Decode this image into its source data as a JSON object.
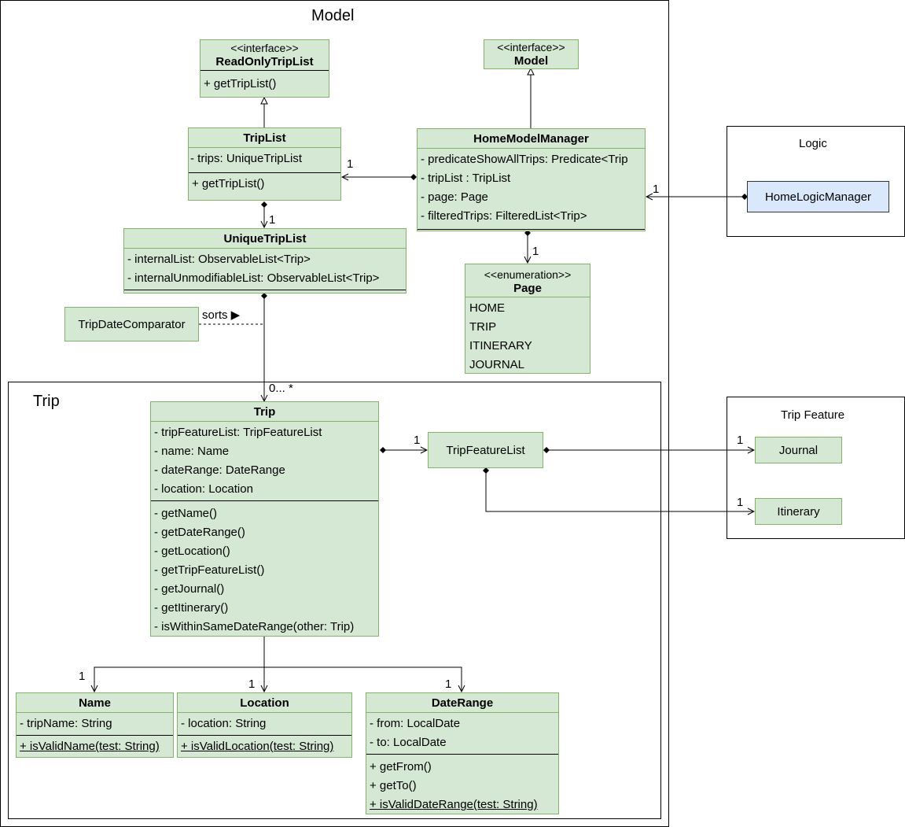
{
  "frames": {
    "model": "Model",
    "trip": "Trip",
    "logic": "Logic",
    "trip_feature": "Trip Feature"
  },
  "classes": {
    "read_only_trip_list": {
      "stereotype": "<<interface>>",
      "name": "ReadOnlyTripList",
      "methods": [
        "+ getTripList()"
      ]
    },
    "model_interface": {
      "stereotype": "<<interface>>",
      "name": "Model"
    },
    "trip_list": {
      "name": "TripList",
      "attributes": [
        "- trips: UniqueTripList"
      ],
      "methods": [
        "+ getTripList()"
      ]
    },
    "home_model_manager": {
      "name": "HomeModelManager",
      "attributes": [
        "- predicateShowAllTrips: Predicate<Trip",
        "- tripList : TripList",
        "- page: Page",
        "- filteredTrips: FilteredList<Trip>"
      ]
    },
    "unique_trip_list": {
      "name": "UniqueTripList",
      "attributes": [
        "- internalList: ObservableList<Trip>",
        "- internalUnmodifiableList: ObservableList<Trip>"
      ]
    },
    "page": {
      "stereotype": "<<enumeration>>",
      "name": "Page",
      "values": [
        "HOME",
        "TRIP",
        "ITINERARY",
        "JOURNAL"
      ]
    },
    "trip_date_comparator": {
      "name": "TripDateComparator"
    },
    "trip": {
      "name": "Trip",
      "attributes": [
        "- tripFeatureList: TripFeatureList",
        "- name: Name",
        "- dateRange: DateRange",
        "- location: Location"
      ],
      "methods": [
        "- getName()",
        "- getDateRange()",
        "- getLocation()",
        "- getTripFeatureList()",
        "- getJournal()",
        "- getItinerary()",
        "- isWithinSameDateRange(other: Trip)"
      ]
    },
    "trip_feature_list": {
      "name": "TripFeatureList"
    },
    "name": {
      "name": "Name",
      "attributes": [
        "- tripName: String"
      ],
      "methods": [
        "+ isValidName(test: String)"
      ]
    },
    "location": {
      "name": "Location",
      "attributes": [
        "- location: String"
      ],
      "methods": [
        "+ isValidLocation(test: String)"
      ]
    },
    "date_range": {
      "name": "DateRange",
      "attributes": [
        "- from: LocalDate",
        "- to: LocalDate"
      ],
      "methods": [
        "+ getFrom()",
        "+ getTo()",
        "+ isValidDateRange(test: String)"
      ]
    },
    "home_logic_manager": {
      "name": "HomeLogicManager"
    },
    "journal": {
      "name": "Journal"
    },
    "itinerary": {
      "name": "Itinerary"
    }
  },
  "labels": {
    "triplist_mult": "1",
    "uniquetriplist_mult": "1",
    "hlm_mult": "1",
    "page_mult": "1",
    "trip_mult": "0... *",
    "sorts": "sorts ▶",
    "tfl_mult": "1",
    "journal_mult": "1",
    "itinerary_mult": "1",
    "name_mult": "1",
    "location_mult": "1",
    "daterange_mult": "1"
  },
  "colors": {
    "class_fill": "#d5e8d4",
    "class_border": "#82b366",
    "logic_fill": "#dae8fc"
  }
}
